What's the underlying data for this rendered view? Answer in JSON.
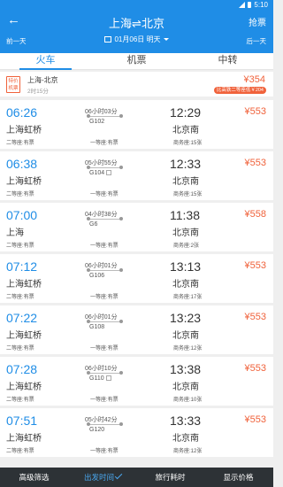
{
  "status_bar": {
    "time": "5:10"
  },
  "header": {
    "back_icon": "arrow-left-icon",
    "title": "上海⇌北京",
    "grab_ticket": "抢票",
    "prev_day": "前一天",
    "next_day": "后一天",
    "date": "01月06日 明天"
  },
  "tabs": [
    {
      "label": "火车",
      "active": true
    },
    {
      "label": "机票",
      "active": false
    },
    {
      "label": "中转",
      "active": false
    }
  ],
  "promo": {
    "badge": "特价机票",
    "route": "上海-北京",
    "duration": "2时15分",
    "price": "¥354",
    "tag": "比高铁二等座低￥204"
  },
  "trains": [
    {
      "dep_time": "06:26",
      "dep_station": "上海虹桥",
      "duration": "06小时03分",
      "train_no": "G102",
      "arr_time": "12:29",
      "arr_station": "北京南",
      "price": "¥553",
      "seat_second": "二等座:有票",
      "seat_first": "一等座:有票",
      "seat_business": "商务座:15张"
    },
    {
      "dep_time": "06:38",
      "dep_station": "上海虹桥",
      "duration": "05小时55分",
      "train_no": "G104",
      "arr_time": "12:33",
      "arr_station": "北京南",
      "price": "¥553",
      "seat_second": "二等座:有票",
      "seat_first": "一等座:有票",
      "seat_business": "商务座:15张"
    },
    {
      "dep_time": "07:00",
      "dep_station": "上海",
      "duration": "04小时38分",
      "train_no": "G6",
      "arr_time": "11:38",
      "arr_station": "北京南",
      "price": "¥558",
      "seat_second": "二等座:有票",
      "seat_first": "一等座:有票",
      "seat_business": "商务座:2张"
    },
    {
      "dep_time": "07:12",
      "dep_station": "上海虹桥",
      "duration": "06小时01分",
      "train_no": "G106",
      "arr_time": "13:13",
      "arr_station": "北京南",
      "price": "¥553",
      "seat_second": "二等座:有票",
      "seat_first": "一等座:有票",
      "seat_business": "商务座:17张"
    },
    {
      "dep_time": "07:22",
      "dep_station": "上海虹桥",
      "duration": "06小时01分",
      "train_no": "G108",
      "arr_time": "13:23",
      "arr_station": "北京南",
      "price": "¥553",
      "seat_second": "二等座:有票",
      "seat_first": "一等座:有票",
      "seat_business": "商务座:12张"
    },
    {
      "dep_time": "07:28",
      "dep_station": "上海虹桥",
      "duration": "06小时10分",
      "train_no": "G110",
      "arr_time": "13:38",
      "arr_station": "北京南",
      "price": "¥553",
      "seat_second": "二等座:有票",
      "seat_first": "一等座:有票",
      "seat_business": "商务座:10张"
    },
    {
      "dep_time": "07:51",
      "dep_station": "上海虹桥",
      "duration": "05小时42分",
      "train_no": "G120",
      "arr_time": "13:33",
      "arr_station": "北京南",
      "price": "¥553",
      "seat_second": "二等座:有票",
      "seat_first": "一等座:有票",
      "seat_business": "商务座:12张"
    }
  ],
  "bottom_bar": {
    "filter": "高级筛选",
    "depart_time": "出发时间",
    "travel_time": "旅行耗时",
    "show_price": "显示价格"
  },
  "colors": {
    "primary": "#1f8de6",
    "price": "#f0623b",
    "bottom_bar": "#2d3236"
  }
}
